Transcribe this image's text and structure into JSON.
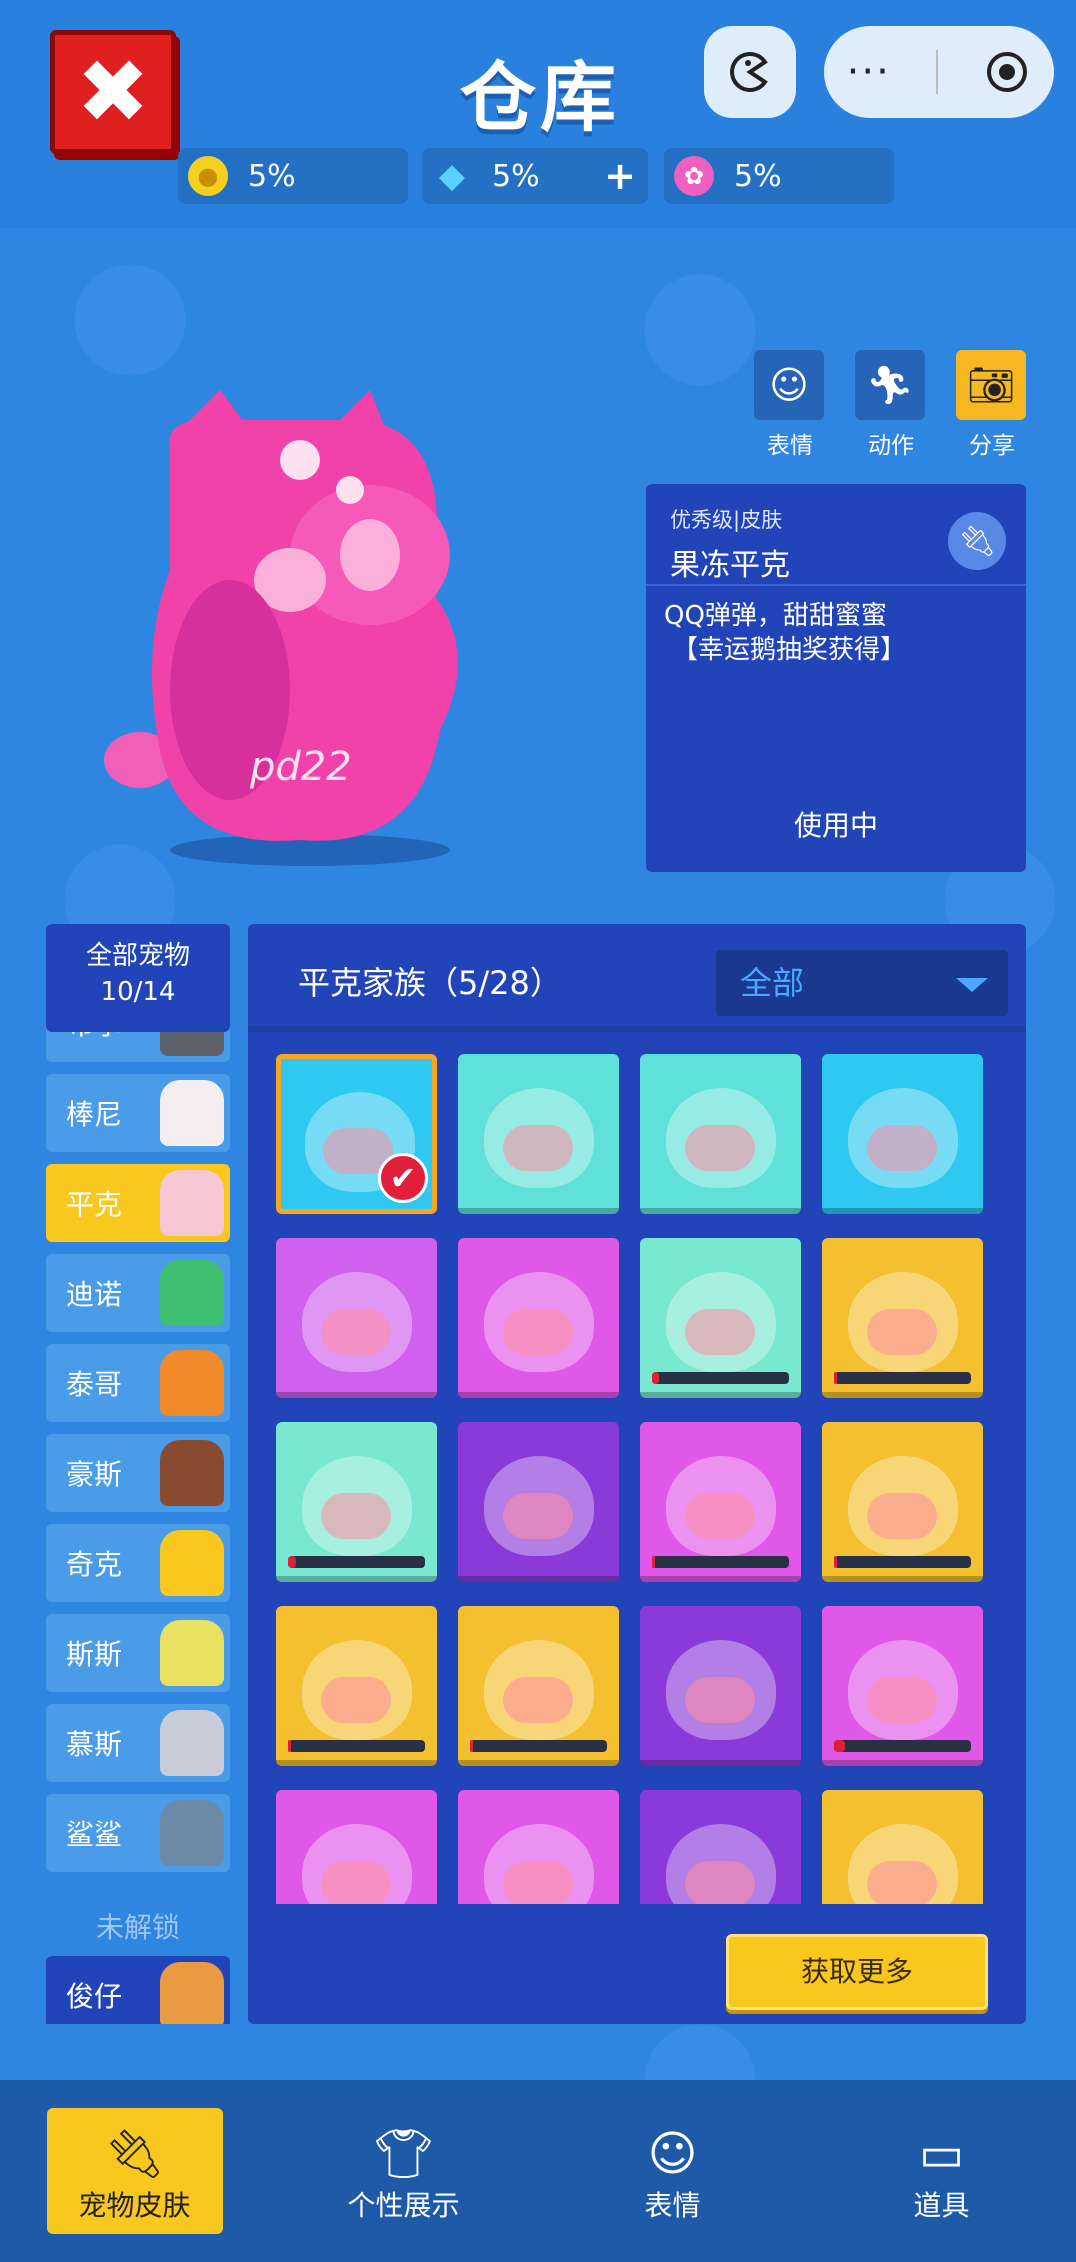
{
  "header": {
    "close_icon": "close-icon",
    "title": "仓库",
    "game_icon": "pacman-icon",
    "menu_icon": "more-dots-icon",
    "target_icon": "target-icon"
  },
  "resources": [
    {
      "name": "gold-coin",
      "icon": "coin-icon",
      "value": "5%",
      "color": "#f5d020"
    },
    {
      "name": "diamond",
      "icon": "diamond-icon",
      "value": "5%",
      "plus": "+",
      "color": "#5ad2ff"
    },
    {
      "name": "lotus",
      "icon": "lotus-icon",
      "value": "5%",
      "color": "#f060c0"
    }
  ],
  "actions": [
    {
      "label": "表情",
      "icon": "emote-icon"
    },
    {
      "label": "动作",
      "icon": "running-icon"
    },
    {
      "label": "分享",
      "icon": "camera-icon"
    }
  ],
  "pet": {
    "watermark": "pd22",
    "color": "#f042a8"
  },
  "skin_info": {
    "rarity": "优秀级|皮肤",
    "name": "果冻平克",
    "desc_line1": "QQ弹弹，甜甜蜜蜜",
    "desc_line2": "【幸运鹅抽奖获得】",
    "status": "使用中"
  },
  "sidebar": {
    "all_label": "全部宠物",
    "all_count": "10/14",
    "items": [
      {
        "label": "布尔",
        "avatar": "#5a5f6a"
      },
      {
        "label": "棒尼",
        "avatar": "#f4eef0"
      },
      {
        "label": "平克",
        "avatar": "#f6c8d6",
        "active": true
      },
      {
        "label": "迪诺",
        "avatar": "#3fc070"
      },
      {
        "label": "泰哥",
        "avatar": "#f08a2a"
      },
      {
        "label": "豪斯",
        "avatar": "#8a4a30"
      },
      {
        "label": "奇克",
        "avatar": "#f8c81e"
      },
      {
        "label": "斯斯",
        "avatar": "#e8e060"
      },
      {
        "label": "慕斯",
        "avatar": "#c8ccd8"
      },
      {
        "label": "鲨鲨",
        "avatar": "#6a8aa8"
      }
    ],
    "locked_label": "未解锁",
    "locked_items": [
      {
        "label": "俊仔",
        "avatar": "#e89a40"
      }
    ]
  },
  "panel": {
    "family": "平克家族（5/28）",
    "filter": "全部",
    "more_button": "获取更多"
  },
  "skins": [
    {
      "bg": "#2ec8f0",
      "selected": true
    },
    {
      "bg": "#5fe0d8"
    },
    {
      "bg": "#5fe0d8"
    },
    {
      "bg": "#2ec8f0"
    },
    {
      "bg": "#d060ee"
    },
    {
      "bg": "#e058e8"
    },
    {
      "bg": "#78e8d0",
      "progress": 0.05
    },
    {
      "bg": "#f5c030",
      "progress": 0.02
    },
    {
      "bg": "#78e8d0",
      "progress": 0.06
    },
    {
      "bg": "#8a3ad8"
    },
    {
      "bg": "#e058e8",
      "progress": 0.02
    },
    {
      "bg": "#f5c030",
      "progress": 0.02
    },
    {
      "bg": "#f5c030",
      "progress": 0.02
    },
    {
      "bg": "#f5c030",
      "progress": 0.02
    },
    {
      "bg": "#8a3ad8"
    },
    {
      "bg": "#e058e8",
      "progress": 0.08
    },
    {
      "bg": "#e058e8"
    },
    {
      "bg": "#e058e8"
    },
    {
      "bg": "#8a3ad8"
    },
    {
      "bg": "#f5c030"
    }
  ],
  "bottom_nav": [
    {
      "label": "宠物皮肤",
      "icon": "plug-icon",
      "active": true
    },
    {
      "label": "个性展示",
      "icon": "tshirt-icon"
    },
    {
      "label": "表情",
      "icon": "emote-icon"
    },
    {
      "label": "道具",
      "icon": "card-icon"
    }
  ]
}
